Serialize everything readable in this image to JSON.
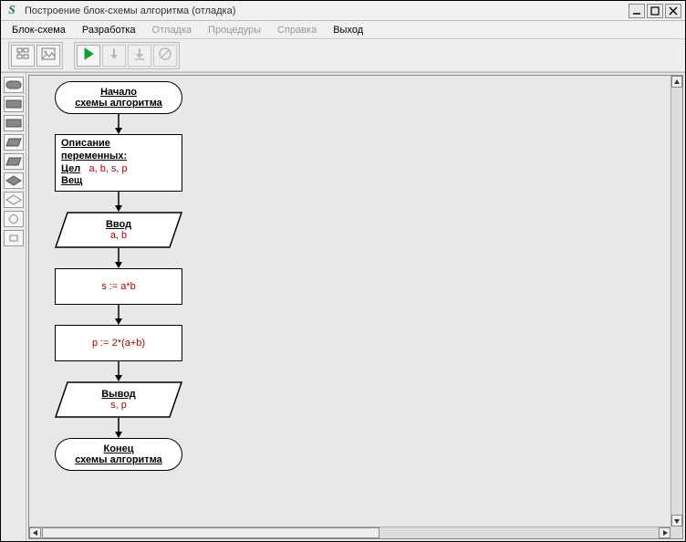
{
  "window": {
    "title": "Построение блок-схемы алгоритма (отладка)"
  },
  "menu": {
    "items": [
      {
        "label": "Блок-схема",
        "enabled": true
      },
      {
        "label": "Разработка",
        "enabled": true
      },
      {
        "label": "Отладка",
        "enabled": false
      },
      {
        "label": "Процедуры",
        "enabled": false
      },
      {
        "label": "Справка",
        "enabled": false
      },
      {
        "label": "Выход",
        "enabled": true
      }
    ]
  },
  "toolbar": {
    "group1": [
      "structure-icon",
      "image-icon"
    ],
    "group2": [
      "play-icon",
      "step-over-icon",
      "step-into-icon",
      "stop-icon"
    ]
  },
  "palette": [
    "terminator-shape",
    "process-shape",
    "process-shape",
    "io-shape",
    "io-shape",
    "decision-shape",
    "connector-shape",
    "circle-shape",
    "mini-shape"
  ],
  "flowchart": {
    "start": {
      "line1": "Начало",
      "line2": "схемы алгоритма"
    },
    "decl": {
      "header": "Описание переменных:",
      "int_label": "Цел",
      "int_vars": "a, b, s, p",
      "real_label": "Вещ"
    },
    "input": {
      "label": "Ввод",
      "vars": "a, b"
    },
    "proc1": {
      "expr": "s := a*b"
    },
    "proc2": {
      "expr": "p := 2*(a+b)"
    },
    "output": {
      "label": "Вывод",
      "vars": "s, p"
    },
    "end": {
      "line1": "Конец",
      "line2": "схемы алгоритма"
    }
  }
}
